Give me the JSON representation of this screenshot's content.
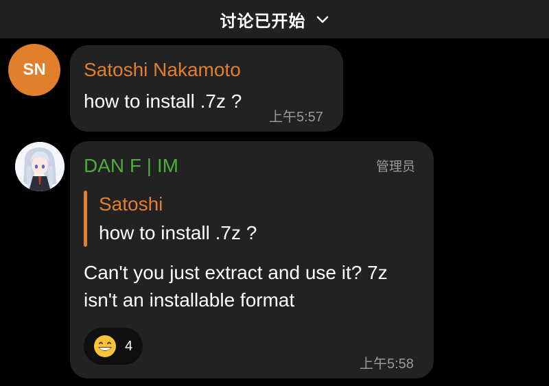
{
  "header": {
    "title": "讨论已开始"
  },
  "messages": [
    {
      "avatar_initials": "SN",
      "sender": "Satoshi Nakamoto",
      "sender_color": "#e07f2c",
      "text": "how to install .7z ?",
      "time": "上午5:57"
    },
    {
      "sender": "DAN F | IM",
      "sender_color": "#4caf3a",
      "role": "管理员",
      "reply_to": {
        "sender": "Satoshi",
        "text": "how to install .7z ?"
      },
      "text_line1": "Can't you just extract and use it? 7z",
      "text_line2": "isn't an installable format",
      "reaction": {
        "emoji_icon": "grinning-face-emoji",
        "count": "4"
      },
      "time": "上午5:58"
    }
  ],
  "colors": {
    "background": "#000000",
    "header_bg": "#212121",
    "bubble_bg": "#222222",
    "accent_orange": "#e07f2c",
    "admin_green": "#4caf3a"
  }
}
